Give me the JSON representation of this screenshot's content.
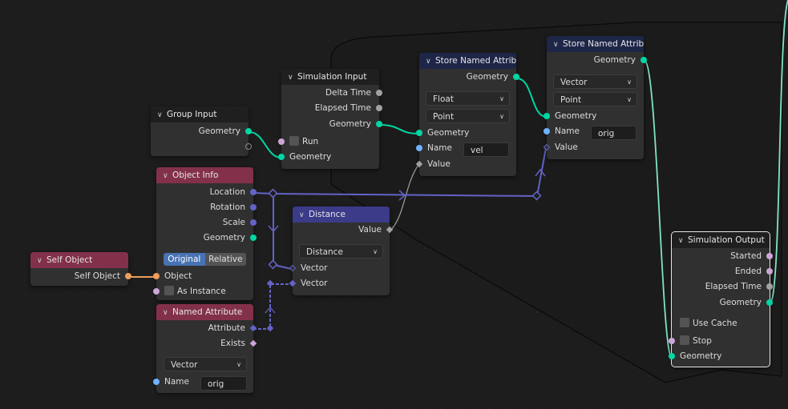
{
  "editor": "Geometry Node Editor",
  "colors": {
    "geometry_socket": "#00d6a3",
    "float_socket": "#a1a1a1",
    "vector_socket": "#6363c7",
    "boolean_socket": "#cca6d6",
    "string_socket": "#70b2ff",
    "object_socket": "#ed9e5c",
    "input_header": "#83314a",
    "attribute_header": "#1e2648",
    "vector_header": "#3b3b8a"
  },
  "nodes": {
    "group_input": {
      "title": "Group Input",
      "outputs": [
        "Geometry"
      ]
    },
    "simulation_input": {
      "title": "Simulation Input",
      "outputs": [
        "Delta Time",
        "Elapsed Time",
        "Geometry"
      ],
      "inputs": [
        "Run",
        "Geometry"
      ]
    },
    "store_attr_1": {
      "title": "Store Named Attribute",
      "outputs": [
        "Geometry"
      ],
      "data_type": "Float",
      "domain": "Point",
      "inputs": [
        "Geometry",
        "Name",
        "Value"
      ],
      "name_value": "vel"
    },
    "store_attr_2": {
      "title": "Store Named Attribute",
      "outputs": [
        "Geometry"
      ],
      "data_type": "Vector",
      "domain": "Point",
      "inputs": [
        "Geometry",
        "Name",
        "Value"
      ],
      "name_value": "orig"
    },
    "object_info": {
      "title": "Object Info",
      "outputs": [
        "Location",
        "Rotation",
        "Scale",
        "Geometry"
      ],
      "mode_options": [
        "Original",
        "Relative"
      ],
      "mode_selected": "Original",
      "inputs": [
        "Object",
        "As Instance"
      ]
    },
    "self_object": {
      "title": "Self Object",
      "outputs": [
        "Self Object"
      ]
    },
    "distance": {
      "title": "Distance",
      "outputs": [
        "Value"
      ],
      "operation": "Distance",
      "inputs": [
        "Vector",
        "Vector"
      ]
    },
    "named_attribute": {
      "title": "Named Attribute",
      "outputs": [
        "Attribute",
        "Exists"
      ],
      "data_type": "Vector",
      "inputs": [
        "Name"
      ],
      "name_value": "orig"
    },
    "simulation_output": {
      "title": "Simulation Output",
      "outputs": [
        "Started",
        "Ended",
        "Elapsed Time",
        "Geometry"
      ],
      "options": [
        "Use Cache",
        "Stop"
      ],
      "inputs": [
        "Geometry"
      ]
    }
  }
}
